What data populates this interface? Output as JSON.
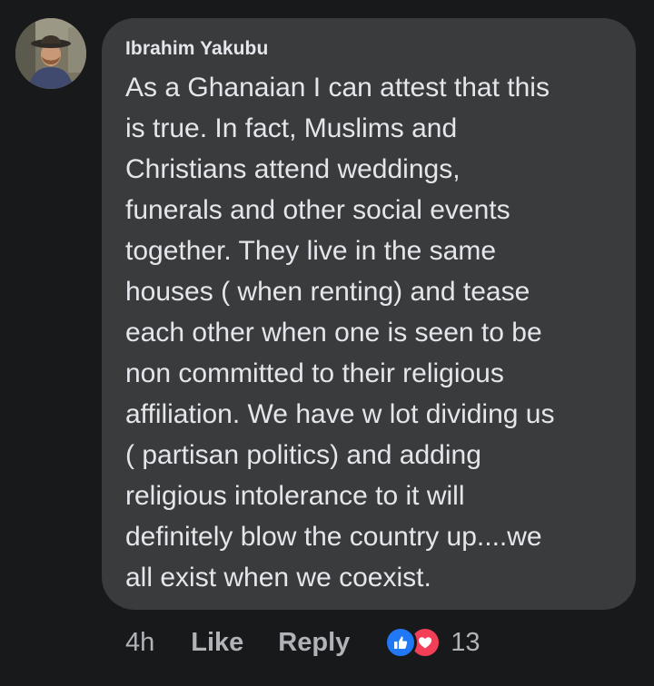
{
  "comment": {
    "author": "Ibrahim Yakubu",
    "lines": [
      "As a Ghanaian I can attest that this",
      "is true. In fact, Muslims and",
      "Christians attend weddings,",
      "funerals and other social events",
      "together. They live in the same",
      "houses ( when renting) and tease",
      "each other when one is seen to be",
      "non committed to their religious",
      "affiliation. We have w lot dividing us",
      "( partisan politics) and adding",
      "religious intolerance to it will",
      "definitely blow the country up....we",
      "all exist when we coexist."
    ]
  },
  "actions": {
    "time": "4h",
    "like_label": "Like",
    "reply_label": "Reply",
    "reaction_count": "13",
    "reactions": [
      "like-icon",
      "love-icon"
    ]
  },
  "colors": {
    "background": "#18191a",
    "bubble": "#3a3b3c",
    "text": "#e4e6eb",
    "secondary_text": "#b0b3b8",
    "like_blue": "#2078f4",
    "love_red": "#f33e58"
  }
}
